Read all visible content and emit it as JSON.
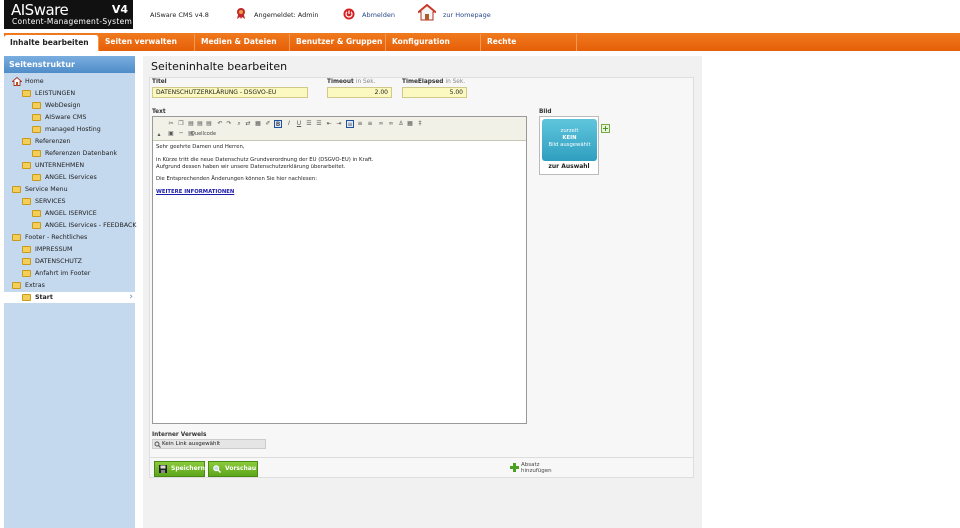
{
  "header": {
    "logo_brand": "AISware",
    "logo_version": "V4",
    "logo_subtitle": "Content-Management-System",
    "cms_version": "AISware CMS v4.8",
    "logged_in": "Angemeldet: Admin",
    "logout": "Abmelden",
    "homepage": "zur Homepage"
  },
  "nav": {
    "items": [
      "Inhalte bearbeiten",
      "Seiten verwalten",
      "Medien & Dateien",
      "Benutzer & Gruppen",
      "Konfiguration",
      "Rechte"
    ],
    "active_index": 0
  },
  "sidebar": {
    "title": "Seitenstruktur",
    "items": [
      {
        "label": "Home",
        "level": 0,
        "icon": "home-icon"
      },
      {
        "label": "LEISTUNGEN",
        "level": 1,
        "icon": "folder-icon"
      },
      {
        "label": "WebDesign",
        "level": 2,
        "icon": "folder-icon"
      },
      {
        "label": "AISware CMS",
        "level": 2,
        "icon": "folder-icon"
      },
      {
        "label": "managed Hosting",
        "level": 2,
        "icon": "folder-icon"
      },
      {
        "label": "Referenzen",
        "level": 1,
        "icon": "folder-icon"
      },
      {
        "label": "Referenzen Datenbank",
        "level": 2,
        "icon": "folder-icon"
      },
      {
        "label": "UNTERNEHMEN",
        "level": 1,
        "icon": "folder-icon"
      },
      {
        "label": "ANGEL IServices",
        "level": 2,
        "icon": "folder-icon"
      },
      {
        "label": "Service Menu",
        "level": 0,
        "icon": "folder-icon"
      },
      {
        "label": "SERVICES",
        "level": 1,
        "icon": "folder-icon"
      },
      {
        "label": "ANGEL ISERVICE",
        "level": 2,
        "icon": "folder-icon"
      },
      {
        "label": "ANGEL IServices - FEEDBACK",
        "level": 2,
        "icon": "folder-icon"
      },
      {
        "label": "Footer - Rechtliches",
        "level": 0,
        "icon": "folder-icon"
      },
      {
        "label": "IMPRESSUM",
        "level": 1,
        "icon": "folder-icon"
      },
      {
        "label": "DATENSCHUTZ",
        "level": 1,
        "icon": "folder-icon"
      },
      {
        "label": "Anfahrt im Footer",
        "level": 1,
        "icon": "folder-icon"
      },
      {
        "label": "Extras",
        "level": 0,
        "icon": "folder-icon"
      },
      {
        "label": "Start",
        "level": 1,
        "icon": "folder-icon",
        "selected": true
      }
    ]
  },
  "main": {
    "page_title": "Seiteninhalte bearbeiten",
    "fields": {
      "titel_label": "Titel",
      "titel_value": "DATENSCHUTZERKLÄRUNG - DSGVO-EU",
      "timeout_label": "Timeout",
      "timeout_unit": "in Sek.",
      "timeout_value": "2.00",
      "elapsed_label": "TimeElapsed",
      "elapsed_unit": "in Sek.",
      "elapsed_value": "5.00"
    },
    "text_label": "Text",
    "editor": {
      "source_label": "Quellcode",
      "paragraphs": [
        "Sehr geehrte Damen und Herren,",
        "in Kürze tritt die neue Datenschutz Grundverordnung der EU (DSGVO-EU) in Kraft.",
        "Aufgrund dessen haben wir unsere Datenschutzerklärung überarbeitet.",
        "Die Entsprechenden Änderungen können Sie hier nachlesen:"
      ],
      "link_text": "WEITERE INFORMATIONEN"
    },
    "bild": {
      "label": "Bild",
      "line1": "zurzeit",
      "line2": "KEIN",
      "line3": "Bild ausgewählt",
      "caption": "zur Auswahl"
    },
    "internal_link": {
      "label": "Interner Verweis",
      "value": "Kein Link ausgewählt"
    },
    "buttons": {
      "save": "Speichern",
      "preview": "Vorschau",
      "absatz_line1": "Absatz",
      "absatz_line2": "hinzufügen"
    }
  },
  "colors": {
    "nav_orange": "#e86a10",
    "sidebar_bg": "#c4d8ee",
    "field_yellow": "#fbf9c0",
    "button_green": "#6cb424",
    "logo_bg": "#111111"
  }
}
